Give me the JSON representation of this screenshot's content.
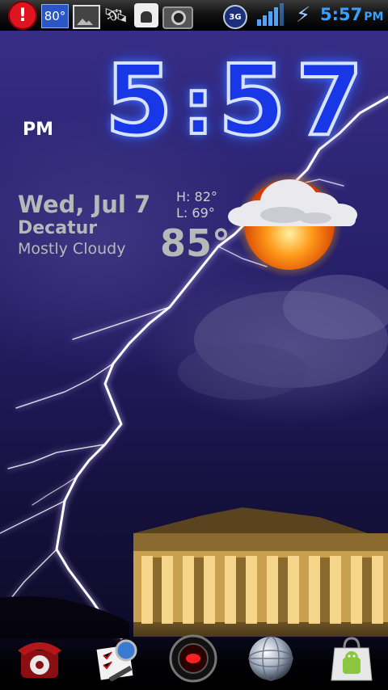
{
  "status_bar": {
    "temperature": "80°",
    "network_type": "3G",
    "time": "5:57",
    "ampm": "PM",
    "icons": [
      "alert-icon",
      "temperature-icon",
      "gallery-icon",
      "satellite-icon",
      "android-debug-icon",
      "camera-icon",
      "network-3g-icon",
      "signal-strength-icon",
      "battery-icon"
    ]
  },
  "clock": {
    "hour": "5",
    "colon": ":",
    "minute_tens": "5",
    "minute_ones": "7",
    "ampm": "PM"
  },
  "weather": {
    "date": "Wed, Jul 7",
    "city": "Decatur",
    "condition": "Mostly Cloudy",
    "high": "H:  82°",
    "low": "L:  69°",
    "current_temp": "85°",
    "icon": "partly-cloudy-sun-icon"
  },
  "dock": {
    "items": [
      {
        "icon": "phone-icon"
      },
      {
        "icon": "tasks-icon"
      },
      {
        "icon": "app-drawer-icon"
      },
      {
        "icon": "browser-globe-icon"
      },
      {
        "icon": "market-icon"
      }
    ]
  },
  "colors": {
    "status_time": "#3aa0ff",
    "clock_digits": "#1838e8",
    "sky": "#2d2574"
  }
}
